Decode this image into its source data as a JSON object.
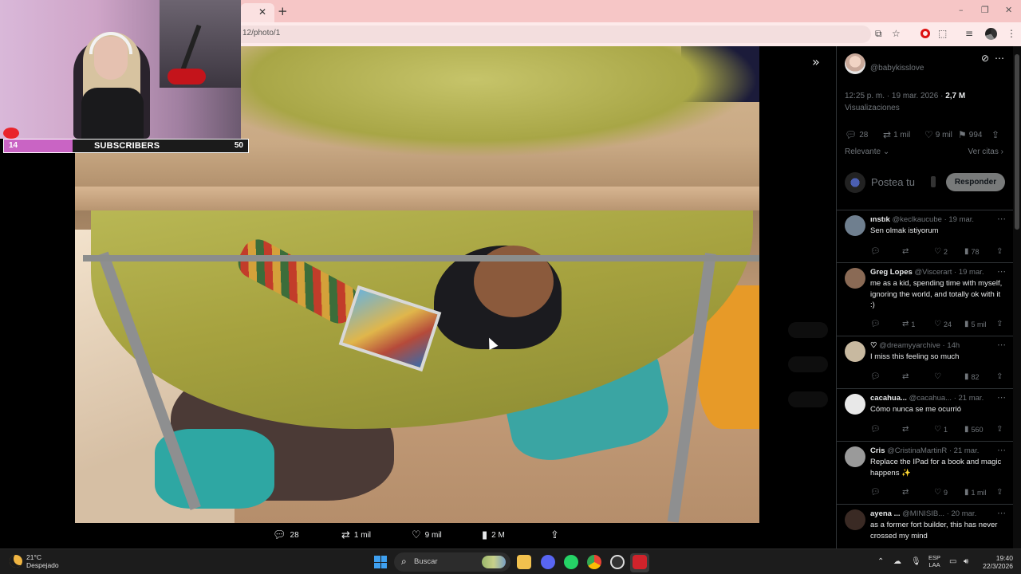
{
  "browser": {
    "tab_close": "✕",
    "new_tab": "+",
    "url": "12/photo/1",
    "icons": [
      "install-icon",
      "star-icon",
      "opera-icon",
      "extensions-icon",
      "media-icon",
      "profile-icon",
      "menu-icon"
    ],
    "window_controls": [
      "–",
      "❐",
      "✕"
    ]
  },
  "stream_overlay": {
    "subscribers_count": "14",
    "subscribers_label": "SUBSCRIBERS",
    "subscribers_goal": "50",
    "subscribers_progress": 0.28,
    "bar_color": "#c964c4"
  },
  "photo_viewer": {
    "actions": {
      "replies": "28",
      "reposts": "1 mil",
      "likes": "9 mil",
      "views": "2 M"
    }
  },
  "post": {
    "handle": "@babykisslove",
    "time": "12:25 p. m. · 19 mar. 2026 · ",
    "views_count": "2,7 M",
    "views_label": "Visualizaciones",
    "stats": {
      "replies": "28",
      "reposts": "1 mil",
      "likes": "9 mil",
      "bookmarks": "994"
    },
    "sort_label": "Relevante",
    "quotes_label": "Ver citas",
    "compose_placeholder": "Postea tu",
    "reply_button": "Responder"
  },
  "replies": [
    {
      "name": "ınstık",
      "handle": "@keclkaucube",
      "time": "· 19 mar.",
      "text": "Sen olmak istiyorum",
      "reply_count": "",
      "repost_count": "",
      "like_count": "2",
      "view_count": "78",
      "avatar_color": "#6f7f8f"
    },
    {
      "name": "Greg Lopes",
      "handle": "@Viscerart",
      "time": "· 19 mar.",
      "text": "me as a kid, spending time with myself, ignoring the world, and totally ok with it :)",
      "reply_count": "",
      "repost_count": "1",
      "like_count": "24",
      "view_count": "5 mil",
      "avatar_color": "#8a6a55"
    },
    {
      "name": "♡",
      "handle": "@dreamyyarchive",
      "time": "· 14h",
      "text": "I miss this feeling so much",
      "reply_count": "",
      "repost_count": "",
      "like_count": "",
      "view_count": "82",
      "avatar_color": "#c8b9a0"
    },
    {
      "name": "cacahua...",
      "handle": "@cacahua...",
      "time": "· 21 mar.",
      "text": "Cómo nunca se me ocurrió",
      "reply_count": "",
      "repost_count": "",
      "like_count": "1",
      "view_count": "560",
      "avatar_color": "#e8e8e8"
    },
    {
      "name": "Cris",
      "handle": "@CristinaMartinR",
      "time": "· 21 mar.",
      "text": "Replace the IPad for a book and magic happens ✨",
      "reply_count": "",
      "repost_count": "",
      "like_count": "9",
      "view_count": "1 mil",
      "avatar_color": "#9a9a9a"
    },
    {
      "name": "ayena ...",
      "handle": "@MINISIB...",
      "time": "· 20 mar.",
      "text": "as a former fort builder, this has never crossed my mind",
      "reply_count": "",
      "repost_count": "",
      "like_count": "",
      "view_count": "",
      "avatar_color": "#3a2a24"
    }
  ],
  "taskbar": {
    "temperature": "21°C",
    "weather": "Despejado",
    "search_placeholder": "Buscar",
    "lang_1": "ESP",
    "lang_2": "LAA",
    "time": "19:40",
    "date": "22/3/2026"
  }
}
